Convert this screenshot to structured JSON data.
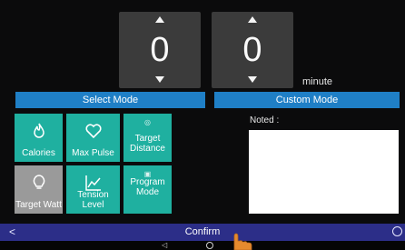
{
  "stepper_hour": {
    "value": "0"
  },
  "stepper_minute": {
    "value": "0",
    "unit": "minute"
  },
  "modes": {
    "select": "Select Mode",
    "custom": "Custom Mode"
  },
  "tiles": {
    "calories": "Calories",
    "max_pulse": "Max Pulse",
    "target_distance_line1": "Target",
    "target_distance_line2": "Distance",
    "target_watt": "Target Watt",
    "tension_level": "Tension Level",
    "program_line1": "Program",
    "program_line2": "Mode"
  },
  "notes": {
    "label": "Noted :"
  },
  "confirm": {
    "label": "Confirm"
  },
  "colors": {
    "teal": "#1fb0a0",
    "grey": "#9a9a9a",
    "mode_blue": "#1f7fc6",
    "confirm_bar": "#2c2e88"
  },
  "icons": [
    "arrow-up-icon",
    "arrow-down-icon",
    "flame-icon",
    "heart-icon",
    "target-icon",
    "bulb-icon",
    "chart-icon",
    "program-icon",
    "back-chevron-icon",
    "settings-icon",
    "nav-back-icon",
    "nav-home-icon",
    "hand-cursor-icon"
  ]
}
